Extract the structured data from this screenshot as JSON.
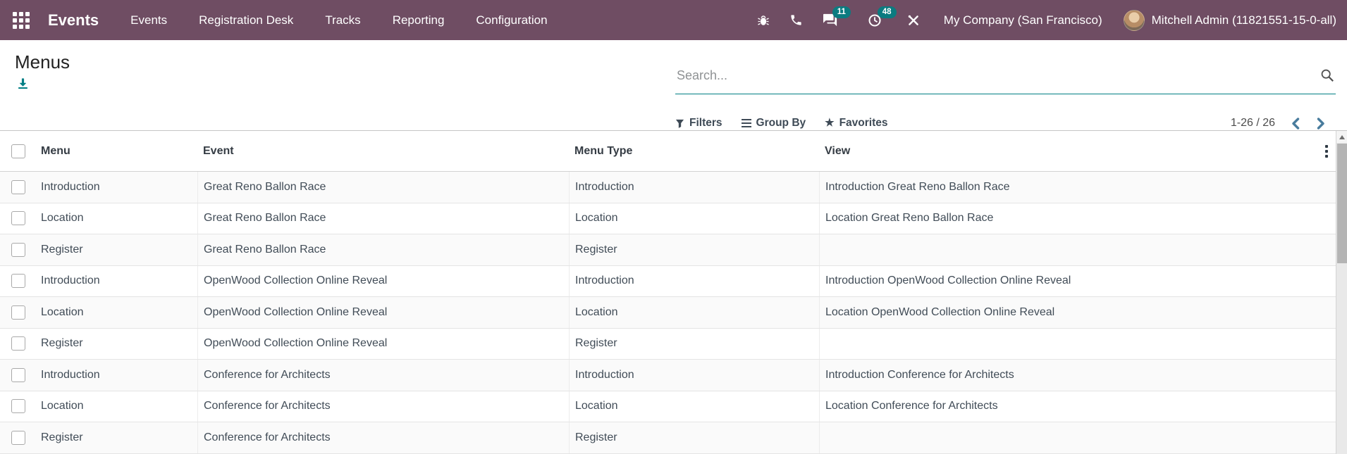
{
  "colors": {
    "navbar_bg": "#6F4D63",
    "accent_teal": "#017E84",
    "badge_bg": "#0B7B80",
    "pager_chevron": "#497C9D",
    "stripe_bg": "#FAFAFA"
  },
  "icons": {
    "apps_menu": "grid-3x3",
    "bug": "bug",
    "phone": "phone-handset",
    "messages": "chat-bubbles",
    "activities": "clock",
    "tools": "crossed-tools",
    "search": "magnifier",
    "export": "download-arrow",
    "filter": "funnel",
    "group_by": "bars",
    "favorites": "star",
    "pager_prev": "chevron-left",
    "pager_next": "chevron-right",
    "column_options": "kebab-vertical",
    "scroll_up": "triangle-up"
  },
  "navbar": {
    "brand": "Events",
    "menu_items": [
      "Events",
      "Registration Desk",
      "Tracks",
      "Reporting",
      "Configuration"
    ],
    "systray": {
      "message_badge": "11",
      "activity_badge": "48",
      "company": "My Company (San Francisco)",
      "user": "Mitchell Admin (11821551-15-0-all)"
    }
  },
  "control_panel": {
    "title": "Menus",
    "search": {
      "placeholder": "Search..."
    },
    "filters": {
      "filters_label": "Filters",
      "group_by_label": "Group By",
      "favorites_label": "Favorites"
    },
    "pager": {
      "range": "1-26 / 26"
    }
  },
  "table": {
    "columns": {
      "menu": "Menu",
      "event": "Event",
      "menu_type": "Menu Type",
      "view": "View"
    },
    "rows": [
      {
        "menu": "Introduction",
        "event": "Great Reno Ballon Race",
        "menu_type": "Introduction",
        "view": "Introduction Great Reno Ballon Race"
      },
      {
        "menu": "Location",
        "event": "Great Reno Ballon Race",
        "menu_type": "Location",
        "view": "Location Great Reno Ballon Race"
      },
      {
        "menu": "Register",
        "event": "Great Reno Ballon Race",
        "menu_type": "Register",
        "view": ""
      },
      {
        "menu": "Introduction",
        "event": "OpenWood Collection Online Reveal",
        "menu_type": "Introduction",
        "view": "Introduction OpenWood Collection Online Reveal"
      },
      {
        "menu": "Location",
        "event": "OpenWood Collection Online Reveal",
        "menu_type": "Location",
        "view": "Location OpenWood Collection Online Reveal"
      },
      {
        "menu": "Register",
        "event": "OpenWood Collection Online Reveal",
        "menu_type": "Register",
        "view": ""
      },
      {
        "menu": "Introduction",
        "event": "Conference for Architects",
        "menu_type": "Introduction",
        "view": "Introduction Conference for Architects"
      },
      {
        "menu": "Location",
        "event": "Conference for Architects",
        "menu_type": "Location",
        "view": "Location Conference for Architects"
      },
      {
        "menu": "Register",
        "event": "Conference for Architects",
        "menu_type": "Register",
        "view": ""
      }
    ]
  }
}
